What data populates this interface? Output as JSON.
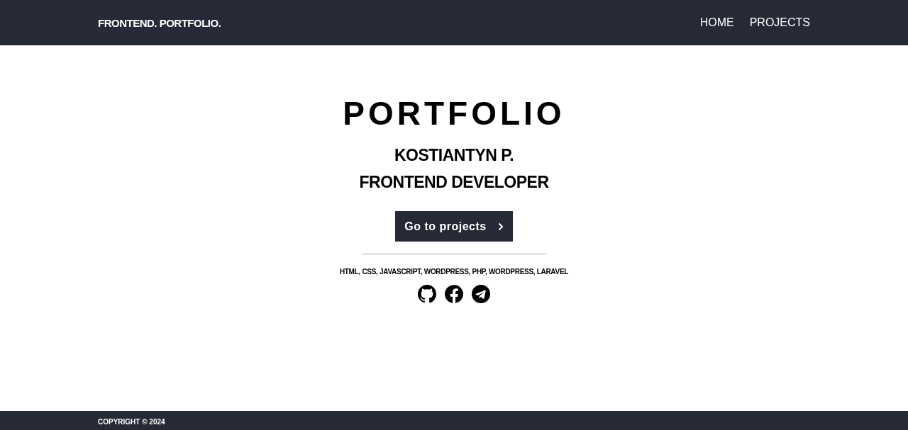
{
  "header": {
    "logo": "FRONTEND. PORTFOLIO.",
    "nav": [
      {
        "label": "HOME"
      },
      {
        "label": "PROJECTS"
      }
    ]
  },
  "hero": {
    "title": "PORTFOLIO",
    "name": "KOSTIANTYN P.",
    "role": "FRONTEND DEVELOPER",
    "button": "Go to projects",
    "skills": "HTML, CSS, JAVASCRIPT, WORDPRESS, PHP, WORDPRESS, LARAVEL",
    "social": [
      {
        "kind": "github"
      },
      {
        "kind": "facebook"
      },
      {
        "kind": "telegram"
      }
    ]
  },
  "footer": {
    "copyright": "COPYRIGHT © 2024"
  }
}
